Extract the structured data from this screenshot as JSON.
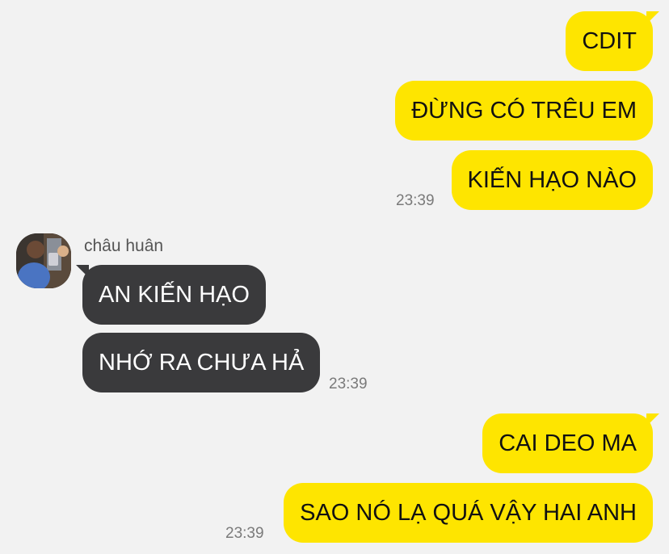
{
  "messages_outgoing_1": [
    {
      "text": "CDIT"
    },
    {
      "text": "ĐỪNG CÓ TRÊU EM"
    },
    {
      "text": "KIẾN HẠO NÀO"
    }
  ],
  "time_1": "23:39",
  "sender": {
    "name": "châu huân",
    "avatar": "user-photo"
  },
  "messages_incoming": [
    {
      "text": "AN KIẾN HẠO"
    },
    {
      "text": "NHỚ RA CHƯA HẢ"
    }
  ],
  "time_2": "23:39",
  "messages_outgoing_2": [
    {
      "text": "CAI DEO MA"
    },
    {
      "text": "SAO NÓ LẠ QUÁ VẬY HAI ANH"
    }
  ],
  "time_3": "23:39",
  "colors": {
    "outgoing_bubble": "#fee500",
    "incoming_bubble": "#3a3a3c",
    "background": "#f2f2f2"
  }
}
